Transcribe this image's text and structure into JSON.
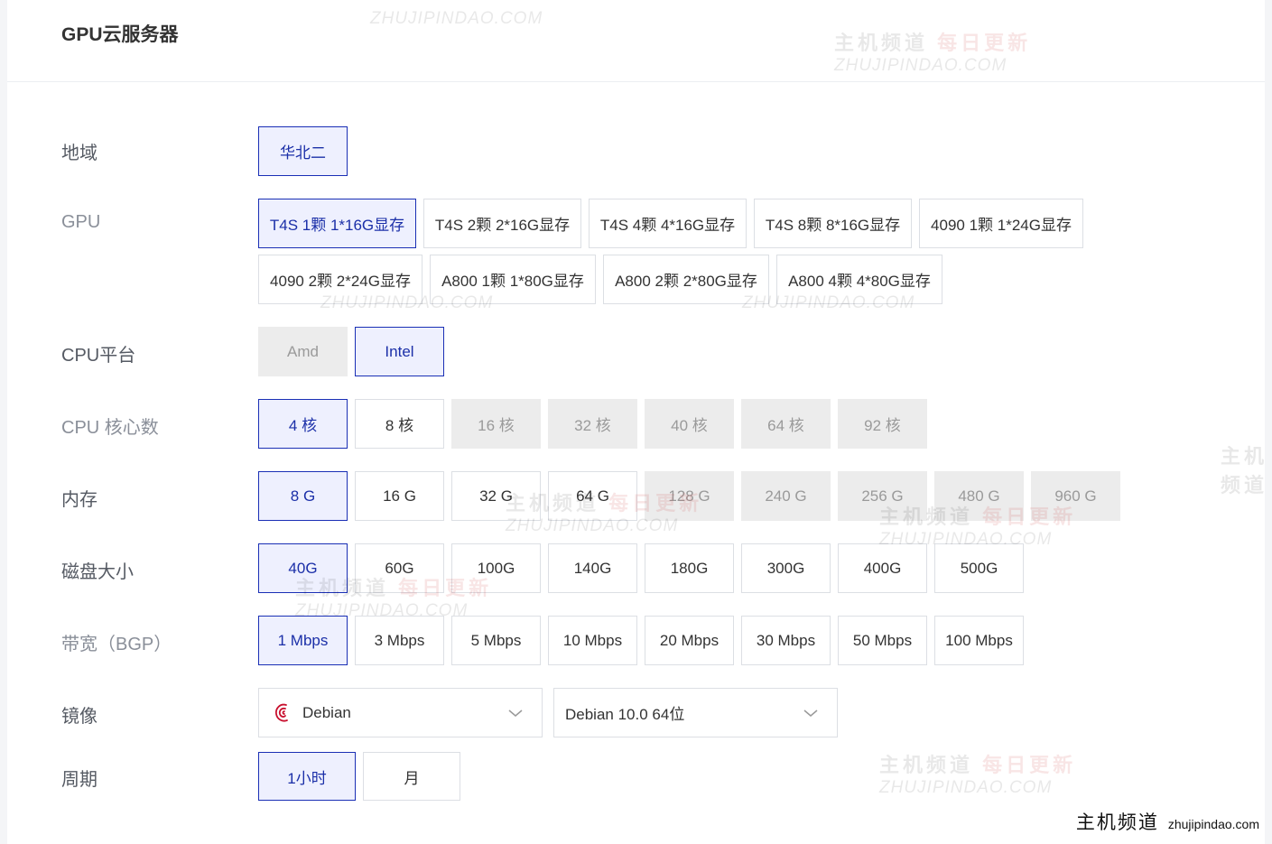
{
  "title": "GPU云服务器",
  "labels": {
    "region": "地域",
    "gpu": "GPU",
    "cpu_platform": "CPU平台",
    "cpu_cores": "CPU 核心数",
    "memory": "内存",
    "disk": "磁盘大小",
    "bandwidth": "带宽（BGP）",
    "image": "镜像",
    "period": "周期"
  },
  "region": [
    "华北二"
  ],
  "gpu": [
    "T4S 1颗 1*16G显存",
    "T4S 2颗 2*16G显存",
    "T4S 4颗 4*16G显存",
    "T4S 8颗 8*16G显存",
    "4090 1颗 1*24G显存",
    "4090 2颗 2*24G显存",
    "A800 1颗 1*80G显存",
    "A800 2颗 2*80G显存",
    "A800 4颗 4*80G显存"
  ],
  "cpu_platform": [
    "Amd",
    "Intel"
  ],
  "cpu_cores": [
    "4 核",
    "8 核",
    "16 核",
    "32 核",
    "40 核",
    "64 核",
    "92 核"
  ],
  "memory": [
    "8 G",
    "16 G",
    "32 G",
    "64 G",
    "128 G",
    "240 G",
    "256 G",
    "480 G",
    "960 G"
  ],
  "disk": [
    "40G",
    "60G",
    "100G",
    "140G",
    "180G",
    "300G",
    "400G",
    "500G"
  ],
  "bandwidth": [
    "1 Mbps",
    "3 Mbps",
    "5 Mbps",
    "10 Mbps",
    "20 Mbps",
    "30 Mbps",
    "50 Mbps",
    "100 Mbps"
  ],
  "image": {
    "os": "Debian",
    "version": "Debian 10.0 64位"
  },
  "period": [
    "1小时",
    "月"
  ],
  "watermark": {
    "cn_a": "主机频道",
    "cn_b": "每日更新",
    "en": "ZHUJIPINDAO.COM"
  },
  "corner": {
    "cn": "主机频道",
    "en": "zhujipindao.com"
  },
  "colors": {
    "accent": "#1b2fa8",
    "selected_bg": "#eef0fe",
    "disabled_bg": "#ececec"
  }
}
